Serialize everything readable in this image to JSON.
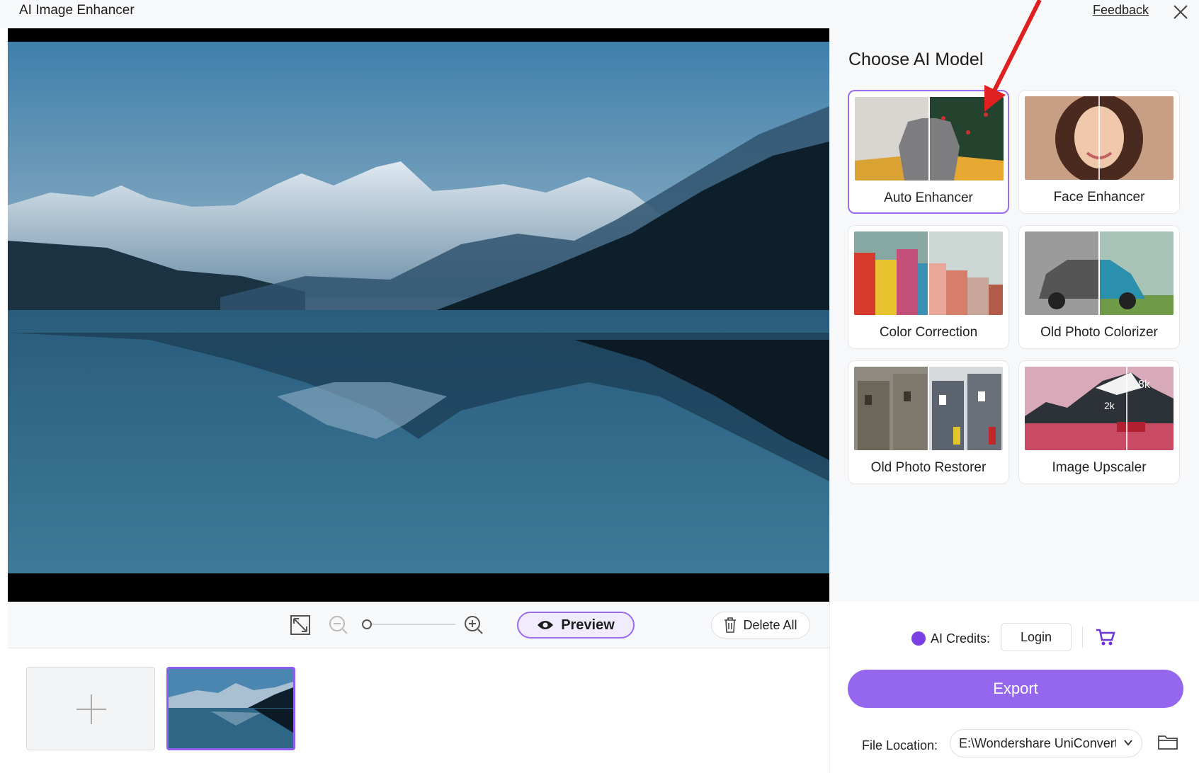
{
  "window": {
    "title": "AI Image Enhancer",
    "feedback_label": "Feedback"
  },
  "side_panel": {
    "title": "Choose AI Model",
    "models": [
      {
        "label": "Auto Enhancer",
        "selected": true
      },
      {
        "label": "Face Enhancer",
        "selected": false
      },
      {
        "label": "Color Correction",
        "selected": false
      },
      {
        "label": "Old Photo Colorizer",
        "selected": false
      },
      {
        "label": "Old Photo Restorer",
        "selected": false
      },
      {
        "label": "Image Upscaler",
        "selected": false
      }
    ],
    "upscaler_badges": {
      "high": "8k",
      "low": "2k"
    }
  },
  "toolbar": {
    "preview_label": "Preview",
    "delete_all_label": "Delete All",
    "zoom_level": 0
  },
  "footer": {
    "credits_label": "AI Credits:",
    "login_label": "Login",
    "export_label": "Export",
    "file_location_label": "File Location:",
    "file_location_value": "E:\\Wondershare UniConverter"
  },
  "colors": {
    "accent": "#9567ee",
    "accent_border": "#9a6cf2",
    "annotation_arrow": "#e02020",
    "credits_dot": "#7b3fe4"
  },
  "icons": [
    "close-icon",
    "fit-screen-icon",
    "zoom-out-icon",
    "zoom-in-icon",
    "eye-icon",
    "trash-icon",
    "plus-icon",
    "cart-icon",
    "chevron-down-icon",
    "folder-icon"
  ]
}
